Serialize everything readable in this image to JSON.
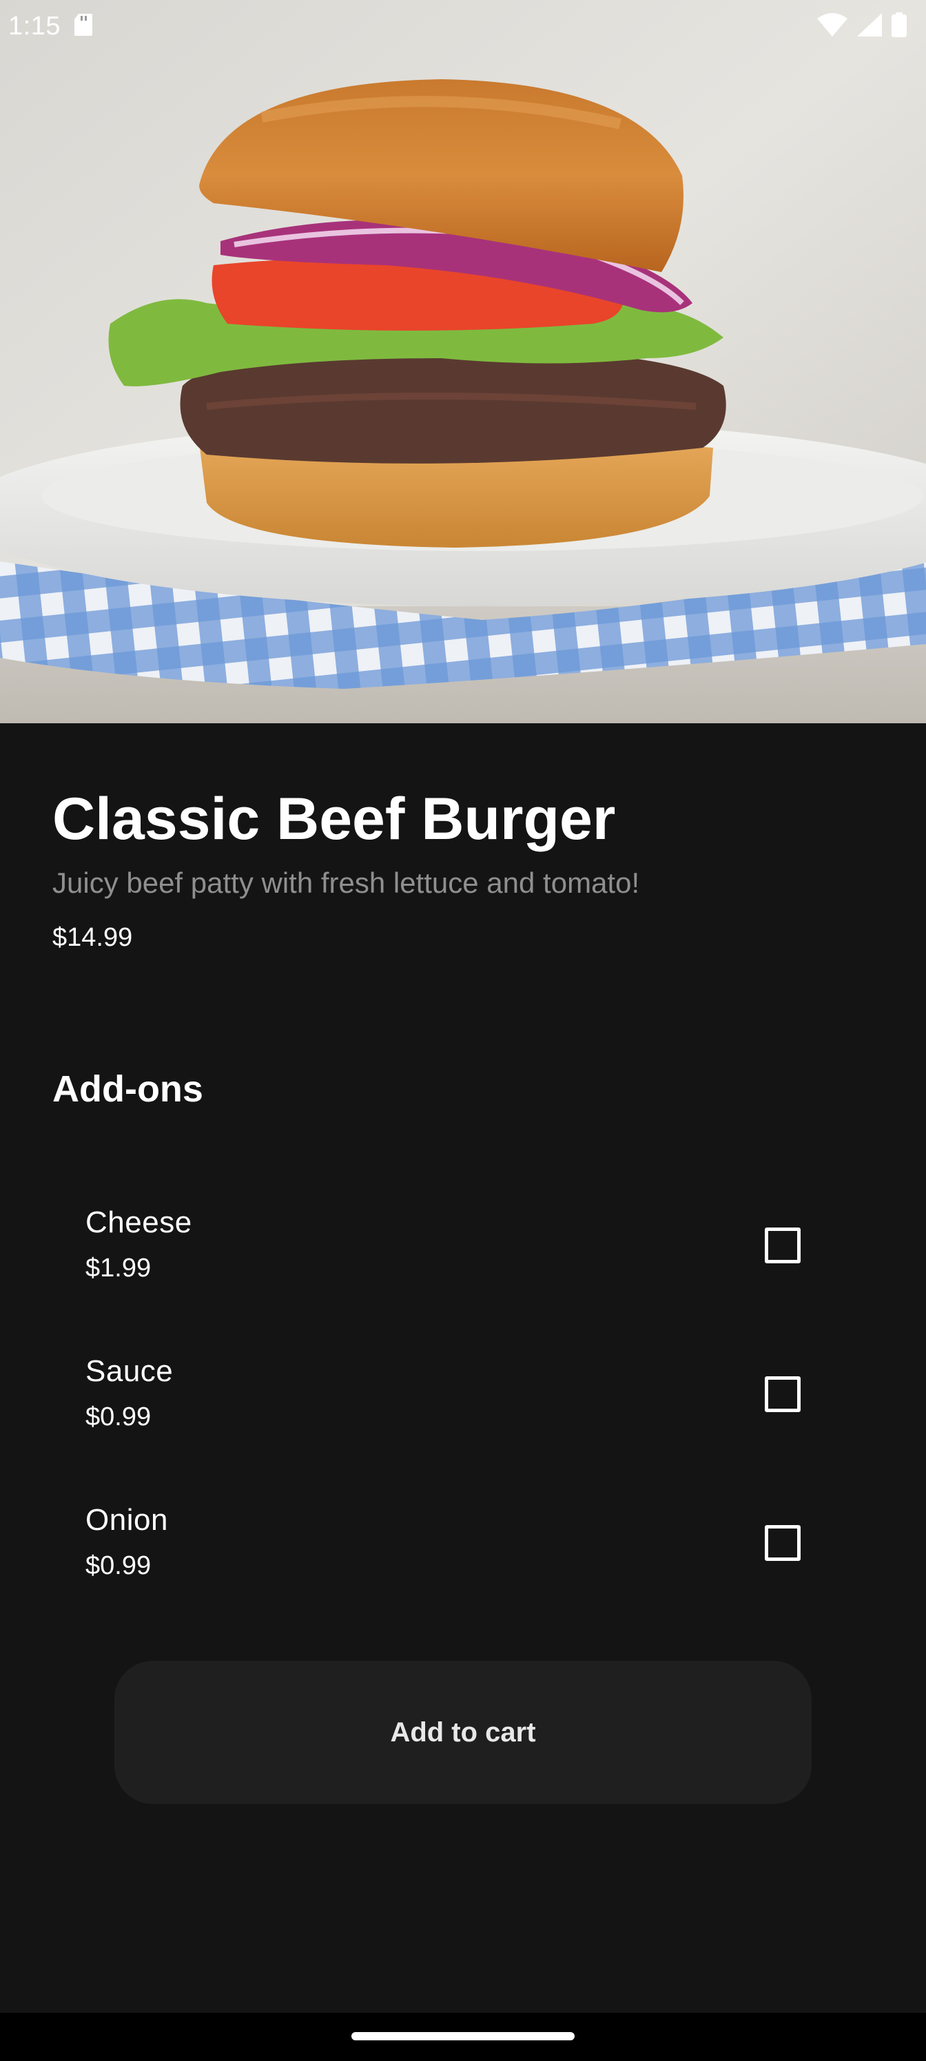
{
  "status_bar": {
    "time": "1:15",
    "icons": [
      "sd-card-icon",
      "wifi-icon",
      "signal-icon",
      "battery-icon"
    ]
  },
  "hero": {
    "image": "burger-photo"
  },
  "product": {
    "name": "Classic Beef Burger",
    "description": "Juicy beef patty with fresh lettuce and tomato!",
    "price": "$14.99"
  },
  "addons": {
    "title": "Add-ons",
    "items": [
      {
        "name": "Cheese",
        "price": "$1.99",
        "checked": false
      },
      {
        "name": "Sauce",
        "price": "$0.99",
        "checked": false
      },
      {
        "name": "Onion",
        "price": "$0.99",
        "checked": false
      }
    ]
  },
  "actions": {
    "add_to_cart_label": "Add to cart"
  },
  "colors": {
    "background": "#141414",
    "button": "#1f1f1f",
    "muted_text": "#8f8f8f"
  }
}
